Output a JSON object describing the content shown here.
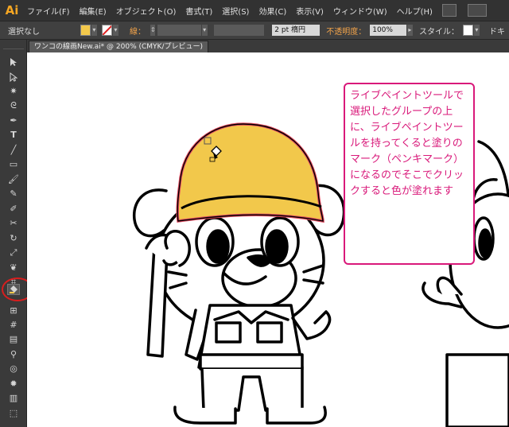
{
  "app": {
    "logo_text": "Ai"
  },
  "menu": [
    "ファイル(F)",
    "編集(E)",
    "オブジェクト(O)",
    "書式(T)",
    "選択(S)",
    "効果(C)",
    "表示(V)",
    "ウィンドウ(W)",
    "ヘルプ(H)"
  ],
  "control_bar": {
    "selection_label": "選択なし",
    "fill_color": "#f2c84b",
    "stroke_label": "線：",
    "stroke_weight": "2 pt 楕円",
    "opacity_label": "不透明度：",
    "opacity_value": "100%",
    "style_label": "スタイル：",
    "doc_label": "ドキ"
  },
  "document_tab": {
    "title": "ワンコの線画New.ai* @ 200% (CMYK/プレビュー)"
  },
  "callout": {
    "text": "ライブペイントツールで選択したグループの上に、ライブペイントツールを持ってくると塗りのマーク（ペンキマーク）になるのでそこでクリックすると色が塗れます"
  },
  "colors": {
    "helmet_fill": "#f2c84b",
    "helmet_stroke": "#e0465c",
    "callout_border": "#d9197a",
    "highlight_circle": "#d81e1e"
  },
  "tools": [
    "selection-tool",
    "direct-selection-tool",
    "magic-wand-tool",
    "lasso-tool",
    "pen-tool",
    "type-tool",
    "line-tool",
    "rectangle-tool",
    "paintbrush-tool",
    "pencil-tool",
    "blob-brush-tool",
    "eraser-tool",
    "rotate-tool",
    "scale-tool",
    "warp-tool",
    "free-transform-tool",
    "shape-builder-tool",
    "live-paint-bucket-tool",
    "perspective-grid-tool",
    "mesh-tool",
    "gradient-tool",
    "eyedropper-tool",
    "blend-tool",
    "symbol-sprayer-tool",
    "column-graph-tool",
    "artboard-tool",
    "slice-tool"
  ]
}
